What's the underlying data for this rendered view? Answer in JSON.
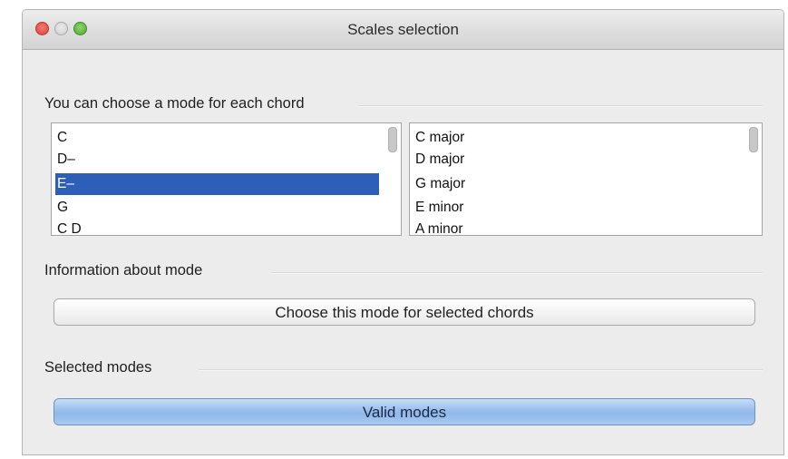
{
  "window": {
    "title": "Scales selection",
    "close_symbol": "×"
  },
  "chords_section": {
    "label": "You can choose a mode for each chord",
    "chords": [
      "C",
      "D–",
      "E–",
      "G",
      "C D"
    ],
    "selected_index": 2
  },
  "modes_list": {
    "modes": [
      "C major",
      "D major",
      "G major",
      "E minor",
      "A minor"
    ]
  },
  "info_section": {
    "label": "Information about mode"
  },
  "choose_button": {
    "label": "Choose this mode for selected chords"
  },
  "selected_section": {
    "label": "Selected modes"
  },
  "valid_button": {
    "label": "Valid modes"
  },
  "colors": {
    "selection": "#2e5fb8",
    "primary_button": "#8fb7e8"
  }
}
